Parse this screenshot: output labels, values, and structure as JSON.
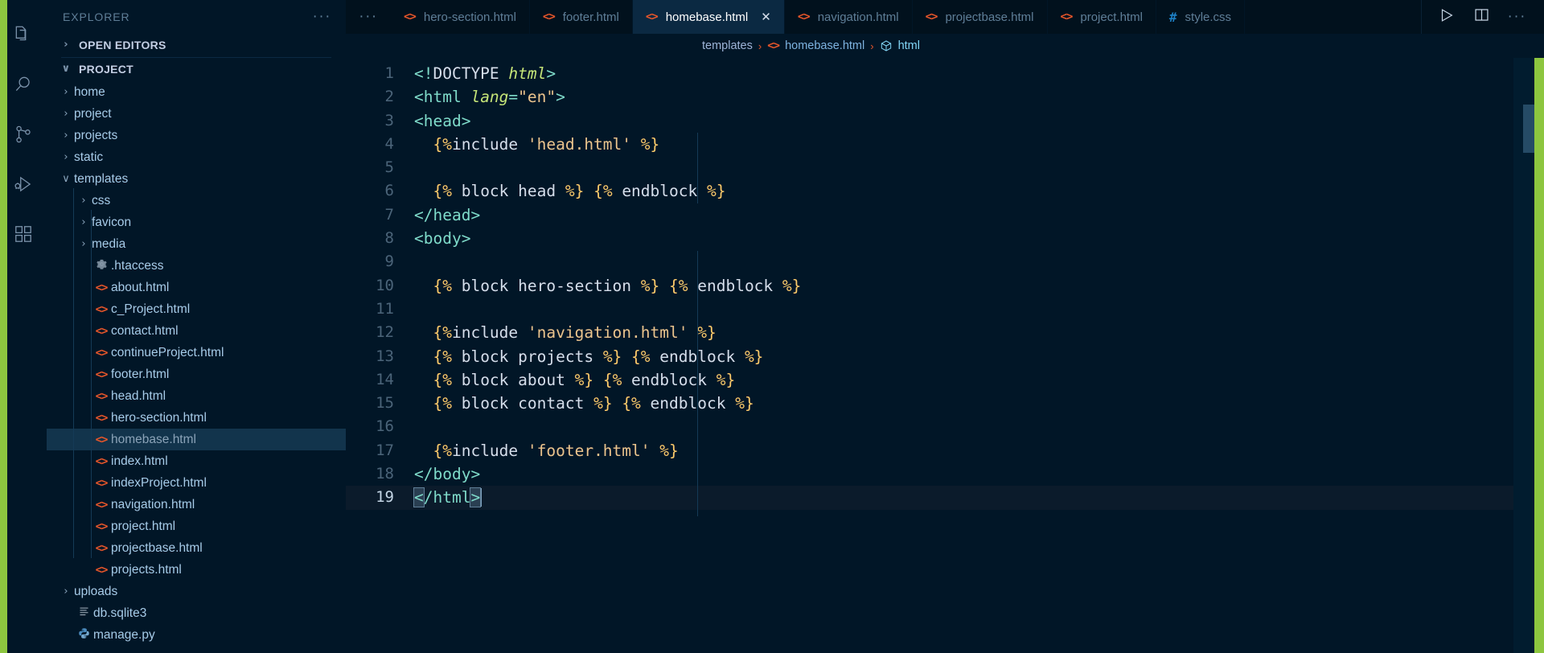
{
  "window": {
    "theme_bg": "#011627",
    "accent": "#8dc63f"
  },
  "activity_bar": {
    "items": [
      {
        "name": "explorer",
        "icon": "files-icon",
        "active": true
      },
      {
        "name": "search",
        "icon": "search-icon",
        "active": false
      },
      {
        "name": "source-control",
        "icon": "source-control-icon",
        "active": false
      },
      {
        "name": "run-and-debug",
        "icon": "run-debug-icon",
        "active": false
      },
      {
        "name": "extensions",
        "icon": "extensions-icon",
        "active": false
      }
    ]
  },
  "sidebar": {
    "title": "EXPLORER",
    "more_actions": "···",
    "sections": [
      {
        "label": "OPEN EDITORS",
        "expanded": false,
        "twisty": "›"
      },
      {
        "label": "PROJECT",
        "expanded": true,
        "twisty": "∨"
      }
    ],
    "tree": [
      {
        "label": "home",
        "type": "folder",
        "depth": 1,
        "expanded": false
      },
      {
        "label": "project",
        "type": "folder",
        "depth": 1,
        "expanded": false
      },
      {
        "label": "projects",
        "type": "folder",
        "depth": 1,
        "expanded": false
      },
      {
        "label": "static",
        "type": "folder",
        "depth": 1,
        "expanded": false
      },
      {
        "label": "templates",
        "type": "folder",
        "depth": 1,
        "expanded": true
      },
      {
        "label": "css",
        "type": "folder",
        "depth": 2,
        "expanded": false
      },
      {
        "label": "favicon",
        "type": "folder",
        "depth": 2,
        "expanded": false
      },
      {
        "label": "media",
        "type": "folder",
        "depth": 2,
        "expanded": false
      },
      {
        "label": ".htaccess",
        "type": "config",
        "depth": 2,
        "icon": "gear-icon"
      },
      {
        "label": "about.html",
        "type": "html",
        "depth": 2,
        "icon": "html-icon"
      },
      {
        "label": "c_Project.html",
        "type": "html",
        "depth": 2,
        "icon": "html-icon"
      },
      {
        "label": "contact.html",
        "type": "html",
        "depth": 2,
        "icon": "html-icon"
      },
      {
        "label": "continueProject.html",
        "type": "html",
        "depth": 2,
        "icon": "html-icon"
      },
      {
        "label": "footer.html",
        "type": "html",
        "depth": 2,
        "icon": "html-icon"
      },
      {
        "label": "head.html",
        "type": "html",
        "depth": 2,
        "icon": "html-icon"
      },
      {
        "label": "hero-section.html",
        "type": "html",
        "depth": 2,
        "icon": "html-icon"
      },
      {
        "label": "homebase.html",
        "type": "html",
        "depth": 2,
        "icon": "html-icon",
        "selected": true
      },
      {
        "label": "index.html",
        "type": "html",
        "depth": 2,
        "icon": "html-icon"
      },
      {
        "label": "indexProject.html",
        "type": "html",
        "depth": 2,
        "icon": "html-icon"
      },
      {
        "label": "navigation.html",
        "type": "html",
        "depth": 2,
        "icon": "html-icon"
      },
      {
        "label": "project.html",
        "type": "html",
        "depth": 2,
        "icon": "html-icon"
      },
      {
        "label": "projectbase.html",
        "type": "html",
        "depth": 2,
        "icon": "html-icon"
      },
      {
        "label": "projects.html",
        "type": "html",
        "depth": 2,
        "icon": "html-icon"
      },
      {
        "label": "uploads",
        "type": "folder",
        "depth": 1,
        "expanded": false
      },
      {
        "label": "db.sqlite3",
        "type": "db",
        "depth": 1,
        "icon": "database-icon"
      },
      {
        "label": "manage.py",
        "type": "python",
        "depth": 1,
        "icon": "python-icon"
      }
    ]
  },
  "tabs": {
    "overflow_indicator": "···",
    "items": [
      {
        "label": "hero-section.html",
        "icon": "html-icon",
        "active": false
      },
      {
        "label": "footer.html",
        "icon": "html-icon",
        "active": false
      },
      {
        "label": "homebase.html",
        "icon": "html-icon",
        "active": true,
        "close": "✕"
      },
      {
        "label": "navigation.html",
        "icon": "html-icon",
        "active": false
      },
      {
        "label": "projectbase.html",
        "icon": "html-icon",
        "active": false
      },
      {
        "label": "project.html",
        "icon": "html-icon",
        "active": false
      },
      {
        "label": "style.css",
        "icon": "css-icon",
        "active": false
      }
    ],
    "actions": [
      {
        "name": "run-button",
        "icon": "play-icon"
      },
      {
        "name": "split-editor-button",
        "icon": "split-editor-icon"
      },
      {
        "name": "more-actions-button",
        "icon": "ellipsis-icon",
        "label": "···"
      }
    ]
  },
  "breadcrumb": {
    "folder": "templates",
    "sep": "›",
    "file": "homebase.html",
    "symbol": "html"
  },
  "editor": {
    "language": "html",
    "cursor_line": 19,
    "total_lines": 19,
    "lines": [
      {
        "n": "1",
        "text": "<!DOCTYPE html>"
      },
      {
        "n": "2",
        "text": "<html lang=\"en\">"
      },
      {
        "n": "3",
        "text": "<head>"
      },
      {
        "n": "4",
        "text": "  {%include 'head.html' %}"
      },
      {
        "n": "5",
        "text": ""
      },
      {
        "n": "6",
        "text": "  {% block head %} {% endblock %}"
      },
      {
        "n": "7",
        "text": "</head>"
      },
      {
        "n": "8",
        "text": "<body>"
      },
      {
        "n": "9",
        "text": ""
      },
      {
        "n": "10",
        "text": "  {% block hero-section %} {% endblock %}"
      },
      {
        "n": "11",
        "text": ""
      },
      {
        "n": "12",
        "text": "  {%include 'navigation.html' %}"
      },
      {
        "n": "13",
        "text": "  {% block projects %} {% endblock %}"
      },
      {
        "n": "14",
        "text": "  {% block about %} {% endblock %}"
      },
      {
        "n": "15",
        "text": "  {% block contact %} {% endblock %}"
      },
      {
        "n": "16",
        "text": ""
      },
      {
        "n": "17",
        "text": "  {%include 'footer.html' %}"
      },
      {
        "n": "18",
        "text": "</body>"
      },
      {
        "n": "19",
        "text": "</html>"
      }
    ]
  }
}
